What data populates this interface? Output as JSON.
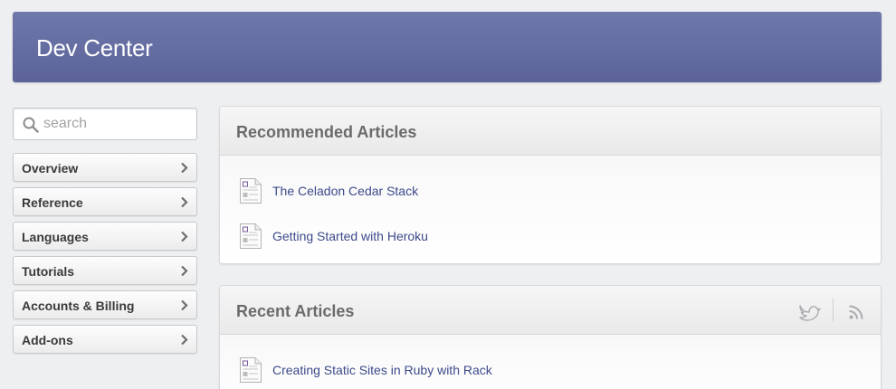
{
  "header": {
    "title": "Dev Center"
  },
  "search": {
    "placeholder": "search"
  },
  "nav": {
    "items": [
      {
        "label": "Overview"
      },
      {
        "label": "Reference"
      },
      {
        "label": "Languages"
      },
      {
        "label": "Tutorials"
      },
      {
        "label": "Accounts & Billing"
      },
      {
        "label": "Add-ons"
      }
    ]
  },
  "recommended": {
    "title": "Recommended Articles",
    "articles": [
      {
        "title": "The Celadon Cedar Stack"
      },
      {
        "title": "Getting Started with Heroku"
      }
    ]
  },
  "recent": {
    "title": "Recent Articles",
    "articles": [
      {
        "title": "Creating Static Sites in Ruby with Rack"
      }
    ]
  },
  "icons": [
    "search-icon",
    "chevron-right-icon",
    "document-icon",
    "twitter-icon",
    "rss-icon"
  ],
  "colors": {
    "header_bg": "#6a73a6",
    "link": "#3c4a8a",
    "page_bg": "#eeeff1"
  }
}
